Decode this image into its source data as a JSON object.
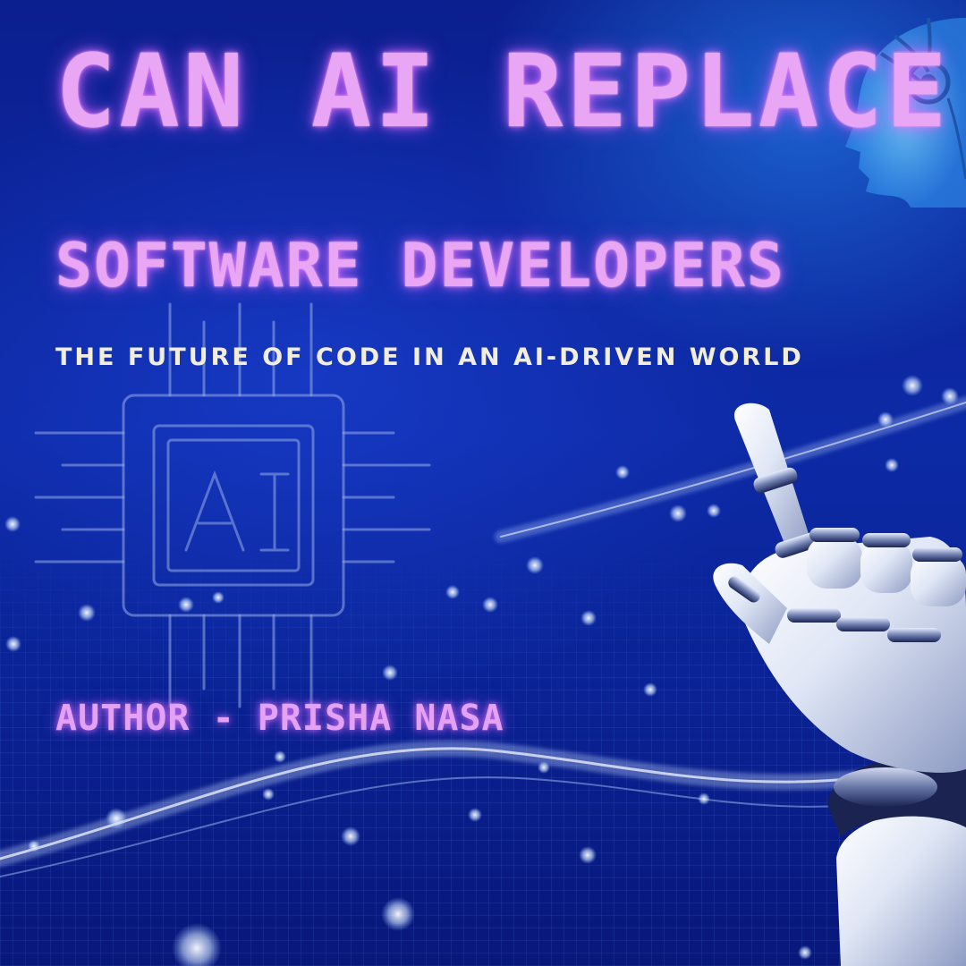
{
  "title": {
    "line1": "CAN AI REPLACE",
    "line2": "SOFTWARE DEVELOPERS"
  },
  "subtitle": "THE FUTURE OF CODE IN AN AI-DRIVEN WORLD",
  "author": "AUTHOR - PRISHA NASA",
  "chip": {
    "label": "AI",
    "icon": "ai-chip-icon"
  },
  "colors": {
    "background": "#0d2aa6",
    "title": "#e9a6f5",
    "subtitle": "#f3eedc",
    "glow": "#c850ff",
    "accent": "#38a8ff"
  }
}
